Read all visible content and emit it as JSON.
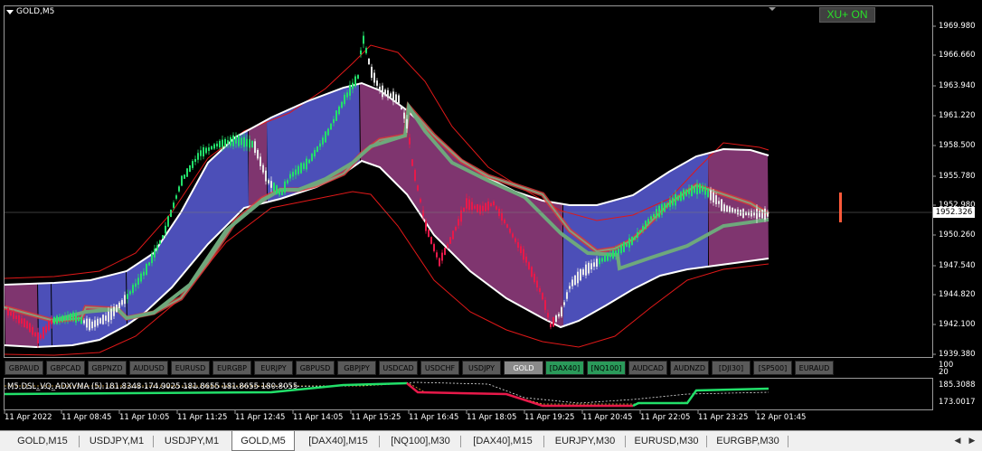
{
  "chart": {
    "symbol_title": "GOLD,M5",
    "button_xu": "XU+ ON",
    "current_price": "1952.326",
    "price_ticks": [
      "1969.980",
      "1966.660",
      "1963.940",
      "1961.220",
      "1958.500",
      "1955.780",
      "1952.980",
      "1950.260",
      "1947.540",
      "1944.820",
      "1942.100",
      "1939.380"
    ],
    "time_ticks": [
      "11 Apr 2022",
      "11 Apr 08:45",
      "11 Apr 10:05",
      "11 Apr 11:25",
      "11 Apr 12:45",
      "11 Apr 14:05",
      "11 Apr 15:25",
      "11 Apr 16:45",
      "11 Apr 18:05",
      "11 Apr 19:25",
      "11 Apr 20:45",
      "11 Apr 22:05",
      "11 Apr 23:25",
      "12 Apr 01:45"
    ],
    "colors": {
      "bull": "#22e06a",
      "bear": "#e8194a",
      "neutral": "#e8e8e8",
      "band_blue": "#5256c8",
      "band_purple": "#8a3a78",
      "envelope": "#ffffff",
      "outer": "#e01818",
      "ma": "#6ea87c"
    }
  },
  "symbol_bar": [
    {
      "label": "GBPAUD",
      "state": "normal"
    },
    {
      "label": "GBPCAD",
      "state": "normal"
    },
    {
      "label": "GBPNZD",
      "state": "normal"
    },
    {
      "label": "AUDUSD",
      "state": "normal"
    },
    {
      "label": "EURUSD",
      "state": "normal"
    },
    {
      "label": "EURGBP",
      "state": "normal"
    },
    {
      "label": "EURJPY",
      "state": "normal"
    },
    {
      "label": "GBPUSD",
      "state": "normal"
    },
    {
      "label": "GBPJPY",
      "state": "normal"
    },
    {
      "label": "USDCAD",
      "state": "normal"
    },
    {
      "label": "USDCHF",
      "state": "normal"
    },
    {
      "label": "USDJPY",
      "state": "normal"
    },
    {
      "label": "GOLD",
      "state": "selected"
    },
    {
      "label": "[DAX40]",
      "state": "green"
    },
    {
      "label": "[NQ100]",
      "state": "green"
    },
    {
      "label": "AUDCAD",
      "state": "normal"
    },
    {
      "label": "AUDNZD",
      "state": "normal"
    },
    {
      "label": "[DJI30]",
      "state": "normal"
    },
    {
      "label": "[SP500]",
      "state": "normal"
    },
    {
      "label": "EURAUD",
      "state": "normal"
    }
  ],
  "indicator": {
    "label": "M5 DSL_VQ_ADXVMA (5)  181.8348 174.9025 181.8655 181.8655 180.8055",
    "scale_top": "100",
    "scale_mid": "20",
    "level_high": "185.3088",
    "level_low": "173.0017"
  },
  "tabs": [
    {
      "label": "GOLD,M15",
      "active": false
    },
    {
      "label": "USDJPY,M1",
      "active": false
    },
    {
      "label": "USDJPY,M1",
      "active": false
    },
    {
      "label": "GOLD,M5",
      "active": true
    },
    {
      "label": "[DAX40],M15",
      "active": false
    },
    {
      "label": "[NQ100],M30",
      "active": false
    },
    {
      "label": "[DAX40],M15",
      "active": false
    },
    {
      "label": "EURJPY,M30",
      "active": false
    },
    {
      "label": "EURUSD,M30",
      "active": false
    },
    {
      "label": "EURGBP,M30",
      "active": false
    }
  ],
  "tab_nav": {
    "prev_icon": "arrow-left-icon",
    "next_icon": "arrow-right-icon"
  }
}
